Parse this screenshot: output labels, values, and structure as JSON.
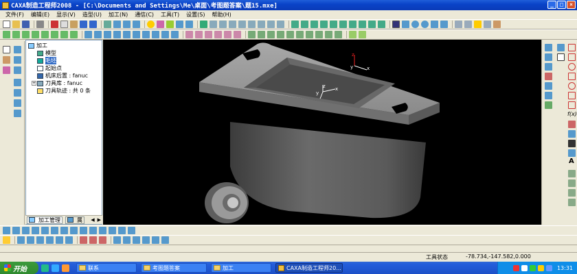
{
  "window": {
    "title": "CAXA制造工程师2008  - [C:\\Documents and Settings\\Me\\桌面\\考图题答案\\题15.mxe]"
  },
  "menu": [
    "文件(F)",
    "编辑(E)",
    "显示(V)",
    "造型(U)",
    "加工(N)",
    "通信(C)",
    "工具(T)",
    "设置(S)",
    "帮助(H)"
  ],
  "tree": {
    "root": "加工",
    "items": [
      {
        "label": "模型"
      },
      {
        "label": "毛坯",
        "selected": true
      },
      {
        "label": "起始点"
      },
      {
        "label": "机床后置 : fanuc"
      },
      {
        "label": "刀具库 : fanuc"
      },
      {
        "label": "刀具轨迹 : 共 0 条"
      }
    ],
    "tabs": [
      "加工管理",
      "属"
    ]
  },
  "viewport": {
    "axis_top": {
      "z": "z",
      "x": "x",
      "y": "y"
    },
    "axis_mid": {
      "z": "z",
      "x": "x",
      "y": "y"
    }
  },
  "status": {
    "mode": "工具状态",
    "coords": "-78.734,-147.582,0.000"
  },
  "taskbar": {
    "start": "开始",
    "buttons": [
      "联系",
      "考图题答案",
      "加工",
      "CAXA制造工程师20..."
    ],
    "clock": "13:31"
  },
  "right_labels": {
    "fxy": "f(x)",
    "text_tool": "A"
  }
}
